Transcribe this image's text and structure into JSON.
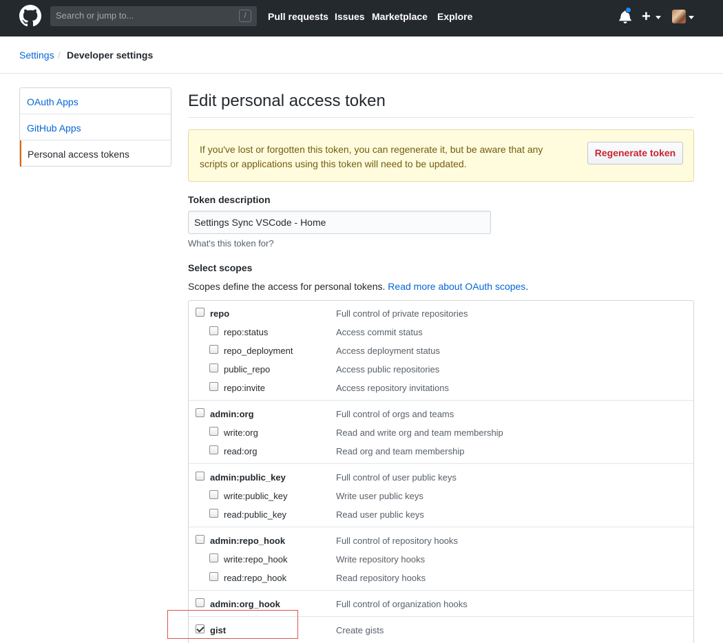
{
  "header": {
    "search_placeholder": "Search or jump to...",
    "search_shortcut": "/",
    "nav": [
      "Pull requests",
      "Issues",
      "Marketplace",
      "Explore"
    ],
    "plus": "+"
  },
  "breadcrumb": {
    "settings": "Settings",
    "separator": "/",
    "current": "Developer settings"
  },
  "sidebar": {
    "items": [
      {
        "label": "OAuth Apps"
      },
      {
        "label": "GitHub Apps"
      },
      {
        "label": "Personal access tokens",
        "selected": true
      }
    ]
  },
  "main": {
    "title": "Edit personal access token",
    "flash": {
      "text": "If you've lost or forgotten this token, you can regenerate it, but be aware that any scripts or applications using this token will need to be updated.",
      "button": "Regenerate token"
    },
    "token_description": {
      "label": "Token description",
      "value": "Settings Sync VSCode - Home",
      "note": "What's this token for?"
    },
    "scopes": {
      "label": "Select scopes",
      "desc": "Scopes define the access for personal tokens.",
      "link": "Read more about OAuth scopes",
      "link_suffix": ".",
      "groups": [
        {
          "name": "repo",
          "desc": "Full control of private repositories",
          "checked": false,
          "children": [
            {
              "name": "repo:status",
              "desc": "Access commit status"
            },
            {
              "name": "repo_deployment",
              "desc": "Access deployment status"
            },
            {
              "name": "public_repo",
              "desc": "Access public repositories"
            },
            {
              "name": "repo:invite",
              "desc": "Access repository invitations"
            }
          ]
        },
        {
          "name": "admin:org",
          "desc": "Full control of orgs and teams",
          "checked": false,
          "children": [
            {
              "name": "write:org",
              "desc": "Read and write org and team membership"
            },
            {
              "name": "read:org",
              "desc": "Read org and team membership"
            }
          ]
        },
        {
          "name": "admin:public_key",
          "desc": "Full control of user public keys",
          "checked": false,
          "children": [
            {
              "name": "write:public_key",
              "desc": "Write user public keys"
            },
            {
              "name": "read:public_key",
              "desc": "Read user public keys"
            }
          ]
        },
        {
          "name": "admin:repo_hook",
          "desc": "Full control of repository hooks",
          "checked": false,
          "children": [
            {
              "name": "write:repo_hook",
              "desc": "Write repository hooks"
            },
            {
              "name": "read:repo_hook",
              "desc": "Read repository hooks"
            }
          ]
        },
        {
          "name": "admin:org_hook",
          "desc": "Full control of organization hooks",
          "checked": false,
          "children": []
        },
        {
          "name": "gist",
          "desc": "Create gists",
          "checked": true,
          "children": []
        }
      ]
    }
  },
  "colors": {
    "header_bg": "#24292e",
    "link": "#0366d6",
    "danger": "#cb2431",
    "flash_bg": "#fffbdd",
    "selected_accent": "#e36209",
    "highlight_box": "#d9534f"
  }
}
